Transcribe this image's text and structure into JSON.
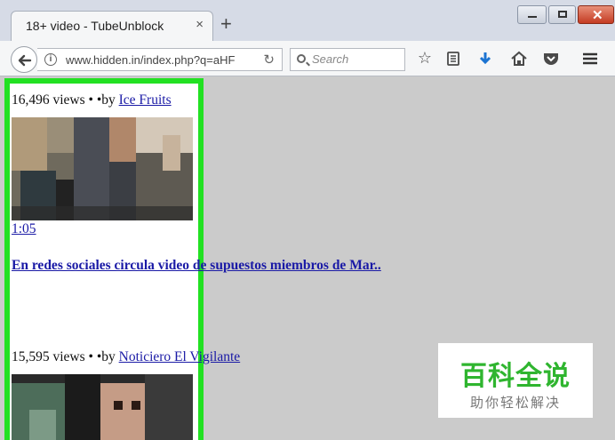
{
  "browser": {
    "tab_title": "18+ video - TubeUnblock",
    "tab_close": "×",
    "new_tab": "+",
    "url": "www.hidden.in/index.php?q=aHF",
    "search_placeholder": "Search",
    "window_close": "✕"
  },
  "videos": [
    {
      "views": "16,496 views • •by ",
      "channel": "Ice Fruits",
      "duration": "1:05",
      "title": "En redes sociales circula video de supuestos miembros de Mar.."
    },
    {
      "views": "15,595 views • •by ",
      "channel": "Noticiero El Vigilante"
    }
  ],
  "watermark": {
    "title": "百科全说",
    "subtitle": "助你轻松解决"
  },
  "colors": {
    "highlight": "#22e122",
    "link": "#1a1aa6",
    "watermark_green": "#2fb52f"
  }
}
